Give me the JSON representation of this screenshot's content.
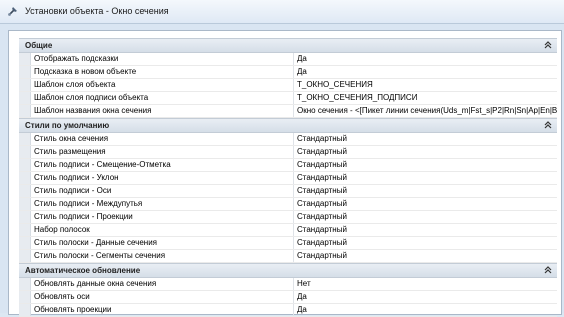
{
  "window": {
    "title": "Установки объекта - Окно сечения"
  },
  "icons": {
    "app": "tool-icon",
    "collapse": "double-chevron-up-icon"
  },
  "colors": {
    "category_bg": "#dde4ec",
    "gutter": "#e7ebf0",
    "window_bg": "#d9e5f2"
  },
  "categories": [
    {
      "label": "Общие",
      "rows": [
        {
          "name": "Отображать подсказки",
          "value": "Да"
        },
        {
          "name": "Подсказка в новом объекте",
          "value": "Да"
        },
        {
          "name": "Шаблон слоя объекта",
          "value": "T_ОКНО_СЕЧЕНИЯ"
        },
        {
          "name": "Шаблон слоя подписи объекта",
          "value": "T_ОКНО_СЕЧЕНИЯ_ПОДПИСИ"
        },
        {
          "name": "Шаблон названия окна сечения",
          "value": "Окно сечения - <[Пикет линии сечения(Uds_m|Fst_s|P2|Rn|Sn|Ap|En|B..."
        }
      ]
    },
    {
      "label": "Стили по умолчанию",
      "rows": [
        {
          "name": "Стиль окна сечения",
          "value": "Стандартный"
        },
        {
          "name": "Стиль размещения",
          "value": "Стандартный"
        },
        {
          "name": "Стиль подписи - Смещение-Отметка",
          "value": "Стандартный"
        },
        {
          "name": "Стиль подписи - Уклон",
          "value": "Стандартный"
        },
        {
          "name": "Стиль подписи - Оси",
          "value": "Стандартный"
        },
        {
          "name": "Стиль подписи - Междупутья",
          "value": "Стандартный"
        },
        {
          "name": "Стиль подписи - Проекции",
          "value": "Стандартный"
        },
        {
          "name": "Набор полосок",
          "value": "Стандартный"
        },
        {
          "name": "Стиль полоски - Данные сечения",
          "value": "Стандартный"
        },
        {
          "name": "Стиль полоски - Сегменты сечения",
          "value": "Стандартный"
        }
      ]
    },
    {
      "label": "Автоматическое обновление",
      "rows": [
        {
          "name": "Обновлять данные окна сечения",
          "value": "Нет"
        },
        {
          "name": "Обновлять оси",
          "value": "Да"
        },
        {
          "name": "Обновлять проекции",
          "value": "Да"
        }
      ]
    }
  ]
}
